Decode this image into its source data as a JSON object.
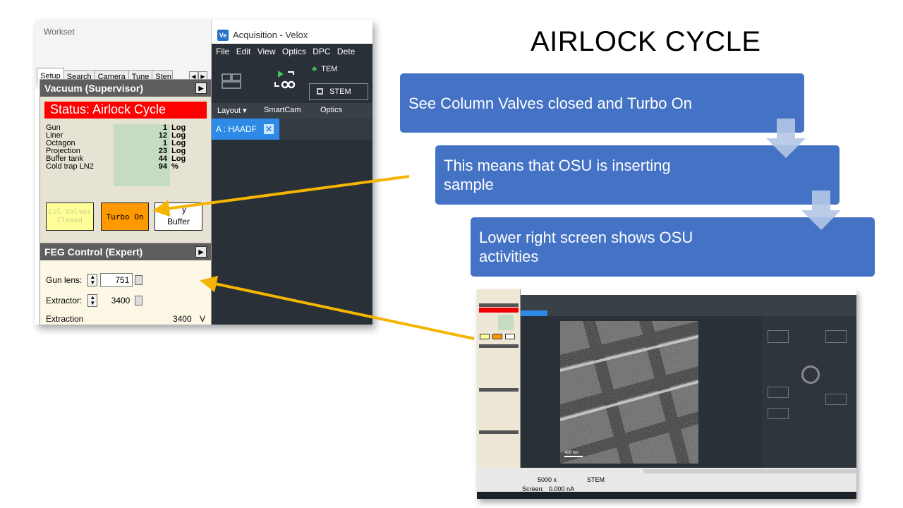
{
  "slide": {
    "title": "AIRLOCK CYCLE"
  },
  "workset": {
    "title": "Workset",
    "tabs": [
      "Setup",
      "Search",
      "Camera",
      "Tune",
      "Sten"
    ],
    "active_tab": "Setup"
  },
  "vacuum": {
    "title": "Vacuum (Supervisor)",
    "status": "Status: Airlock Cycle",
    "rows": [
      {
        "label": "Gun",
        "value": "1",
        "unit": "Log"
      },
      {
        "label": "Liner",
        "value": "12",
        "unit": "Log"
      },
      {
        "label": "Octagon",
        "value": "1",
        "unit": "Log"
      },
      {
        "label": "Projection",
        "value": "23",
        "unit": "Log"
      },
      {
        "label": "Buffer tank",
        "value": "44",
        "unit": "Log"
      },
      {
        "label": "Cold trap LN2",
        "value": "94",
        "unit": "%"
      }
    ],
    "buttons": {
      "col_valves": "Col-Valves Closed",
      "turbo": "Turbo On",
      "buffer": "Buffer",
      "buffer_partial": "y"
    }
  },
  "feg": {
    "title": "FEG Control (Expert)",
    "gun_lens_label": "Gun lens:",
    "gun_lens_value": "751",
    "extractor_label": "Extractor:",
    "extractor_value": "3400",
    "extraction_label": "Extraction",
    "extraction_value": "3400",
    "extraction_unit": "V"
  },
  "velox": {
    "window_title": "Acquisition - Velox",
    "logo": "Ve",
    "menu": [
      "File",
      "Edit",
      "View",
      "Optics",
      "DPC",
      "Dete"
    ],
    "tem_label": "TEM",
    "stem_label": "STEM",
    "layout_label": "Layout ▾",
    "smartcam_label": "SmartCam",
    "optics_label": "Optics",
    "tab_label": "A : HAADF"
  },
  "steps": [
    "See Column Valves closed and Turbo On",
    "This means that OSU is inserting sample",
    "Lower right screen shows OSU activities"
  ],
  "screenshot": {
    "mag": "5000 x",
    "mode": "STEM",
    "screen_label": "Screen:",
    "screen_value": "0.000 nA",
    "scale_label": "400 nm"
  },
  "colors": {
    "step_box": "#4472c4",
    "arrow": "#f5b400",
    "status_red": "#ff0000",
    "turbo_orange": "#ff9900",
    "velox_tab": "#2d8ae6"
  }
}
